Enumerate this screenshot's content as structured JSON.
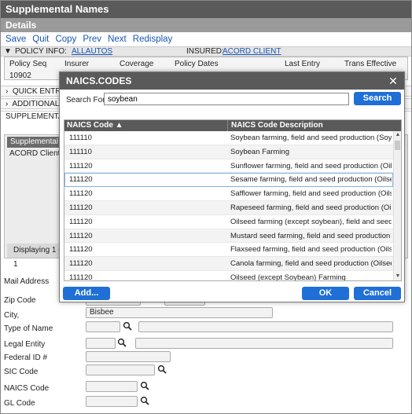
{
  "window": {
    "title": "Supplemental Names",
    "section": "Details"
  },
  "toolbar": {
    "items": [
      "Save",
      "Quit",
      "Copy",
      "Prev",
      "Next",
      "Redisplay"
    ]
  },
  "policy_info": {
    "label": "POLICY INFO:",
    "account": "ALLAUTOS",
    "insured_label": "INSURED:",
    "insured": "ACORD CLIENT"
  },
  "policy_table": {
    "headers": [
      "Policy Seq",
      "Insurer",
      "Coverage",
      "Policy Dates",
      "Last Entry",
      "Trans Effective"
    ],
    "row": [
      "10902"
    ]
  },
  "sections": {
    "quick_entry": "QUICK ENTRY",
    "additional": "ADDITIONAL I",
    "supplemental": "SUPPLEMENTAL N"
  },
  "supp_panel": {
    "header": "Supplemental ...",
    "cell": "ACORD Client",
    "footer": "Displaying 1 - 1"
  },
  "form": {
    "mail_address": "Mail Address",
    "zip_code": "Zip Code",
    "city": "City,",
    "city_value": "Bisbee",
    "type_of_name": "Type of Name",
    "legal_entity": "Legal Entity",
    "federal_id": "Federal ID #",
    "sic_code": "SIC Code",
    "naics_code": "NAICS Code",
    "gl_code": "GL Code"
  },
  "dialog": {
    "title": "NAICS.CODES",
    "close": "✕",
    "search_label": "Search For:",
    "search_value": "soybean",
    "search_button": "Search",
    "col_code": "NAICS Code ▲",
    "col_desc": "NAICS Code Description",
    "rows": [
      {
        "code": "111110",
        "desc": "Soybean farming, field and seed production (Soyb..."
      },
      {
        "code": "111110",
        "desc": "Soybean Farming"
      },
      {
        "code": "111120",
        "desc": "Sunflower farming, field and seed production (Oils..."
      },
      {
        "code": "111120",
        "desc": "Sesame farming, field and seed production (Oilsee..."
      },
      {
        "code": "111120",
        "desc": "Safflower farming, field and seed production (Oils..."
      },
      {
        "code": "111120",
        "desc": "Rapeseed farming, field and seed production (Oils..."
      },
      {
        "code": "111120",
        "desc": "Oilseed farming (except soybean), field and seed p..."
      },
      {
        "code": "111120",
        "desc": "Mustard seed farming, field and seed production (..."
      },
      {
        "code": "111120",
        "desc": "Flaxseed farming, field and seed production (Oils..."
      },
      {
        "code": "111120",
        "desc": "Canola farming, field and seed production (Oilsee..."
      },
      {
        "code": "111120",
        "desc": "Oilseed (except Soybean) Farming"
      }
    ],
    "add_button": "Add...",
    "ok_button": "OK",
    "cancel_button": "Cancel"
  }
}
